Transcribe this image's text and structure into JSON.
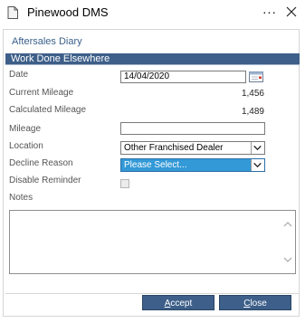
{
  "window": {
    "title": "Pinewood DMS",
    "ellipsis": "...",
    "close": "×"
  },
  "dialog": {
    "title": "Aftersales Diary",
    "section_header": "Work Done Elsewhere"
  },
  "form": {
    "date_label": "Date",
    "date_value": "14/04/2020",
    "current_mileage_label": "Current Mileage",
    "current_mileage_value": "1,456",
    "calculated_mileage_label": "Calculated Mileage",
    "calculated_mileage_value": "1,489",
    "mileage_label": "Mileage",
    "mileage_value": "",
    "location_label": "Location",
    "location_value": "Other Franchised Dealer",
    "decline_reason_label": "Decline Reason",
    "decline_reason_value": "Please Select...",
    "disable_reminder_label": "Disable Reminder",
    "notes_label": "Notes",
    "notes_value": ""
  },
  "buttons": {
    "accept_first": "A",
    "accept_rest": "ccept",
    "close_first": "C",
    "close_rest": "lose"
  },
  "colors": {
    "accent": "#3d5f89",
    "selection": "#3399d7",
    "dialog_title": "#3a5f8a"
  }
}
